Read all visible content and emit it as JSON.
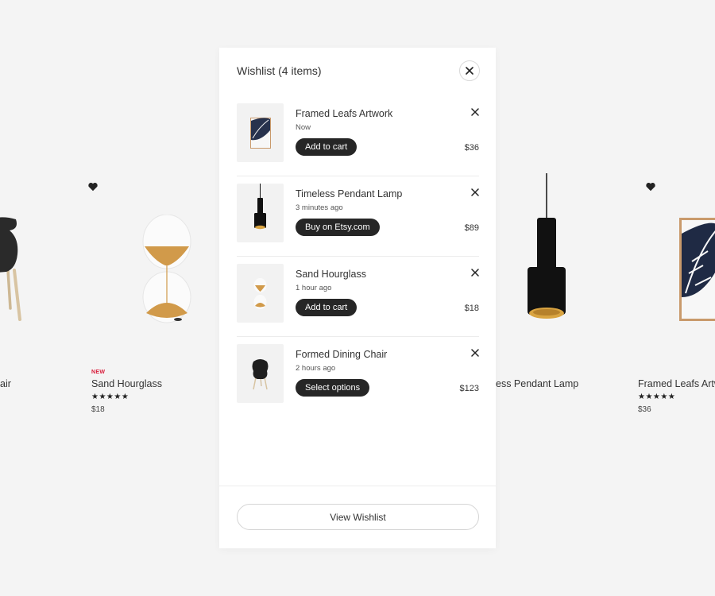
{
  "background": {
    "products": [
      {
        "name": "Formed Dining Chair",
        "visible_name": "air",
        "price": null,
        "badge": null,
        "rating": null,
        "wishlisted": false
      },
      {
        "name": "Sand Hourglass",
        "badge": "NEW",
        "rating": "★★★★★",
        "price": "$18",
        "wishlisted": true
      },
      {
        "name": "Timeless Pendant Lamp",
        "visible_name": "ess Pendant Lamp",
        "price": null,
        "badge": null,
        "rating": null,
        "wishlisted": false
      },
      {
        "name": "Framed Leafs Artwork",
        "visible_name": "Framed Leafs Artw",
        "rating": "★★★★★",
        "price": "$36",
        "badge": null,
        "wishlisted": true
      }
    ]
  },
  "wishlist": {
    "title": "Wishlist (4 items)",
    "close_icon": "close-icon",
    "items": [
      {
        "name": "Framed Leafs Artwork",
        "added": "Now",
        "action": "Add to cart",
        "price": "$36",
        "thumb": "artwork"
      },
      {
        "name": "Timeless Pendant Lamp",
        "added": "3 minutes ago",
        "action": "Buy on Etsy.com",
        "price": "$89",
        "thumb": "lamp"
      },
      {
        "name": "Sand Hourglass",
        "added": "1 hour ago",
        "action": "Add to cart",
        "price": "$18",
        "thumb": "hourglass"
      },
      {
        "name": "Formed Dining Chair",
        "added": "2 hours ago",
        "action": "Select options",
        "price": "$123",
        "thumb": "chair"
      }
    ],
    "view_button": "View Wishlist"
  },
  "colors": {
    "background": "#f4f4f4",
    "button_dark": "#262626",
    "badge_new": "#d81b3a",
    "panel": "#ffffff"
  }
}
